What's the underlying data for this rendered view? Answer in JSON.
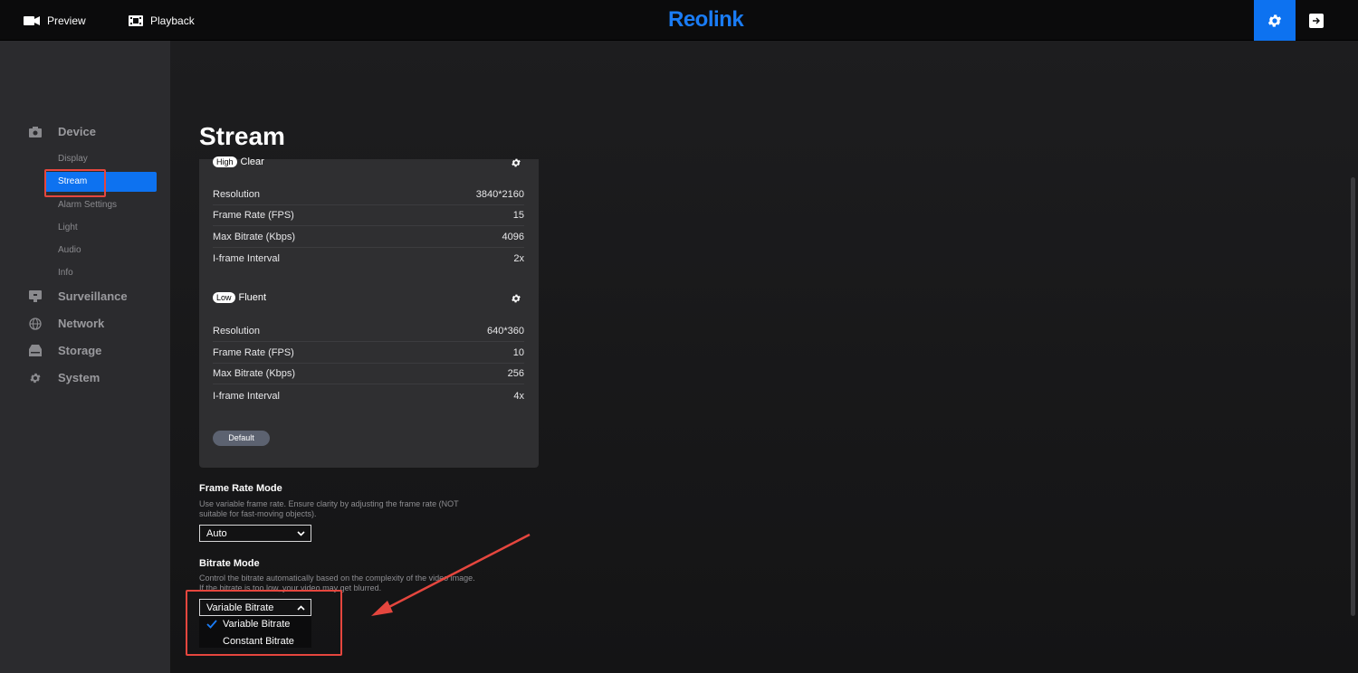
{
  "topbar": {
    "preview_label": "Preview",
    "playback_label": "Playback",
    "logo_text": "Reolink"
  },
  "sidebar": {
    "groups": [
      {
        "label": "Device",
        "icon": "camera-icon"
      },
      {
        "label": "Surveillance",
        "icon": "monitor-icon"
      },
      {
        "label": "Network",
        "icon": "globe-icon"
      },
      {
        "label": "Storage",
        "icon": "storage-icon"
      },
      {
        "label": "System",
        "icon": "gear-icon"
      }
    ],
    "device_items": [
      "Display",
      "Stream",
      "Alarm Settings",
      "Light",
      "Audio",
      "Info"
    ],
    "active_item": "Stream"
  },
  "page": {
    "title": "Stream"
  },
  "streams": {
    "high": {
      "badge": "High",
      "name": "Clear",
      "rows": [
        {
          "label": "Resolution",
          "value": "3840*2160"
        },
        {
          "label": "Frame Rate (FPS)",
          "value": "15"
        },
        {
          "label": "Max Bitrate (Kbps)",
          "value": "4096"
        },
        {
          "label": "I-frame Interval",
          "value": "2x"
        }
      ]
    },
    "low": {
      "badge": "Low",
      "name": "Fluent",
      "rows": [
        {
          "label": "Resolution",
          "value": "640*360"
        },
        {
          "label": "Frame Rate (FPS)",
          "value": "10"
        },
        {
          "label": "Max Bitrate (Kbps)",
          "value": "256"
        },
        {
          "label": "I-frame Interval",
          "value": "4x"
        }
      ]
    },
    "default_label": "Default"
  },
  "frame_rate_mode": {
    "title": "Frame Rate Mode",
    "description": "Use variable frame rate. Ensure clarity by adjusting the frame rate (NOT suitable for fast-moving objects).",
    "value": "Auto"
  },
  "bitrate_mode": {
    "title": "Bitrate Mode",
    "description": "Control the bitrate automatically based on the complexity of the video image. If the bitrate is too low, your video may get blurred.",
    "value": "Variable Bitrate",
    "options": [
      "Variable Bitrate",
      "Constant Bitrate"
    ]
  },
  "colors": {
    "accent": "#0d72f0",
    "annotation": "#e5463e",
    "logo": "#1a7cf5"
  }
}
